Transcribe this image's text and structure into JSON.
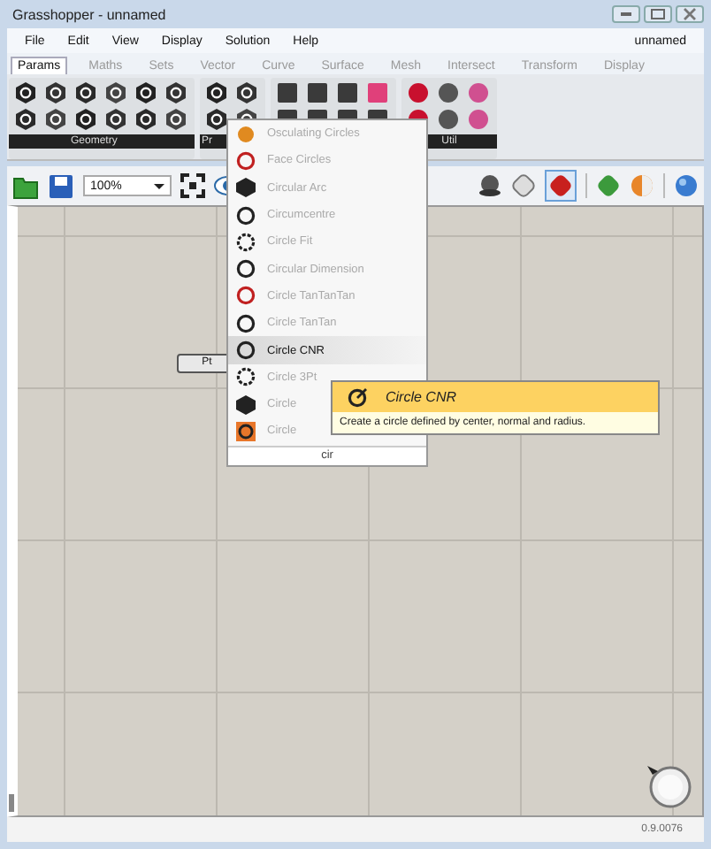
{
  "window": {
    "title": "Grasshopper - unnamed"
  },
  "menu": {
    "items": [
      "File",
      "Edit",
      "View",
      "Display",
      "Solution",
      "Help"
    ],
    "document": "unnamed"
  },
  "tabs": [
    {
      "label": "Params",
      "selected": true
    },
    {
      "label": "Maths",
      "selected": false
    },
    {
      "label": "Sets",
      "selected": false
    },
    {
      "label": "Vector",
      "selected": false
    },
    {
      "label": "Curve",
      "selected": false
    },
    {
      "label": "Surface",
      "selected": false
    },
    {
      "label": "Mesh",
      "selected": false
    },
    {
      "label": "Intersect",
      "selected": false
    },
    {
      "label": "Transform",
      "selected": false
    },
    {
      "label": "Display",
      "selected": false
    }
  ],
  "ribbon_panels": [
    {
      "label": "Geometry"
    },
    {
      "label": "Pr"
    },
    {
      "label": "Util"
    }
  ],
  "toolbar": {
    "zoom": "100%"
  },
  "canvas": {
    "node": "Pt"
  },
  "dropdown": {
    "items": [
      {
        "label": "Osculating Circles",
        "selected": false
      },
      {
        "label": "Face Circles",
        "selected": false
      },
      {
        "label": "Circular Arc",
        "selected": false
      },
      {
        "label": "Circumcentre",
        "selected": false
      },
      {
        "label": "Circle Fit",
        "selected": false
      },
      {
        "label": "Circular Dimension",
        "selected": false
      },
      {
        "label": "Circle TanTanTan",
        "selected": false
      },
      {
        "label": "Circle TanTan",
        "selected": false
      },
      {
        "label": "Circle CNR",
        "selected": true
      },
      {
        "label": "Circle 3Pt",
        "selected": false
      },
      {
        "label": "Circle",
        "selected": false
      },
      {
        "label": "Circle",
        "selected": false
      }
    ],
    "search": "cir"
  },
  "tooltip": {
    "title": "Circle CNR",
    "description": "Create a circle defined by center, normal and radius."
  },
  "status_bar": {
    "version": "0.9.0076"
  }
}
